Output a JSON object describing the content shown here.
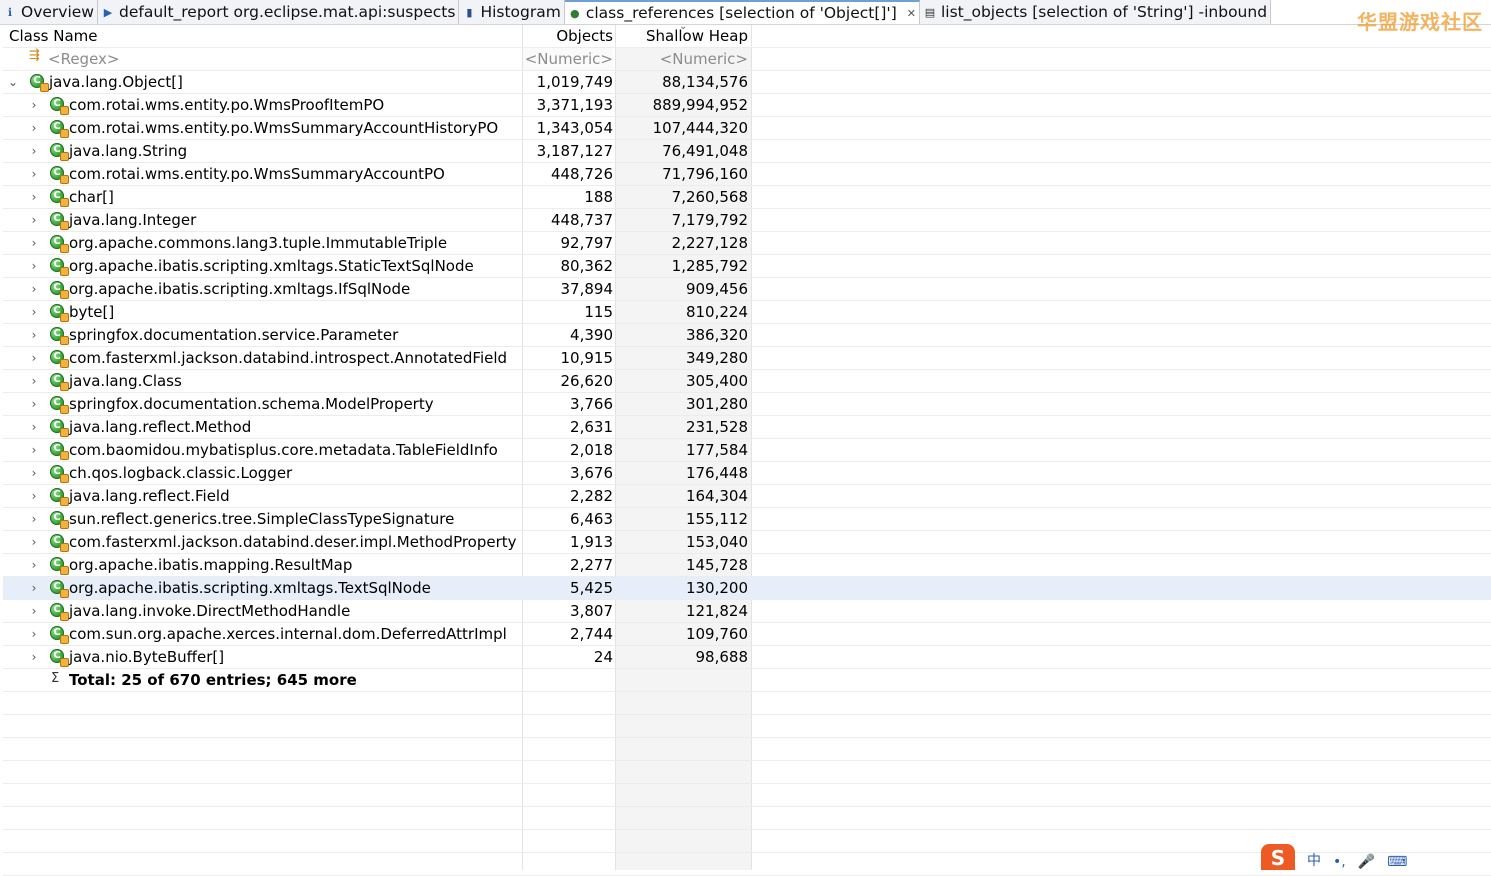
{
  "tabs": [
    {
      "label": "Overview",
      "icon": "info-icon",
      "active": false
    },
    {
      "label": "default_report  org.eclipse.mat.api:suspects",
      "icon": "report-icon",
      "active": false
    },
    {
      "label": "Histogram",
      "icon": "histogram-icon",
      "active": false
    },
    {
      "label": "class_references  [selection of 'Object[]']",
      "icon": "class-references-icon",
      "active": true
    },
    {
      "label": "list_objects  [selection of 'String'] -inbound",
      "icon": "list-objects-icon",
      "active": false
    }
  ],
  "watermark": "华盟游戏社区",
  "columns": {
    "name": "Class Name",
    "objects": "Objects",
    "heap": "Shallow Heap"
  },
  "filter": {
    "name": "<Regex>",
    "objects": "<Numeric>",
    "heap": "<Numeric>"
  },
  "root": {
    "name": "java.lang.Object[]",
    "objects": "1,019,749",
    "heap": "88,134,576"
  },
  "rows": [
    {
      "name": "com.rotai.wms.entity.po.WmsProofItemPO",
      "objects": "3,371,193",
      "heap": "889,994,952"
    },
    {
      "name": "com.rotai.wms.entity.po.WmsSummaryAccountHistoryPO",
      "objects": "1,343,054",
      "heap": "107,444,320"
    },
    {
      "name": "java.lang.String",
      "objects": "3,187,127",
      "heap": "76,491,048"
    },
    {
      "name": "com.rotai.wms.entity.po.WmsSummaryAccountPO",
      "objects": "448,726",
      "heap": "71,796,160"
    },
    {
      "name": "char[]",
      "objects": "188",
      "heap": "7,260,568"
    },
    {
      "name": "java.lang.Integer",
      "objects": "448,737",
      "heap": "7,179,792"
    },
    {
      "name": "org.apache.commons.lang3.tuple.ImmutableTriple",
      "objects": "92,797",
      "heap": "2,227,128"
    },
    {
      "name": "org.apache.ibatis.scripting.xmltags.StaticTextSqlNode",
      "objects": "80,362",
      "heap": "1,285,792"
    },
    {
      "name": "org.apache.ibatis.scripting.xmltags.IfSqlNode",
      "objects": "37,894",
      "heap": "909,456"
    },
    {
      "name": "byte[]",
      "objects": "115",
      "heap": "810,224"
    },
    {
      "name": "springfox.documentation.service.Parameter",
      "objects": "4,390",
      "heap": "386,320"
    },
    {
      "name": "com.fasterxml.jackson.databind.introspect.AnnotatedField",
      "objects": "10,915",
      "heap": "349,280"
    },
    {
      "name": "java.lang.Class",
      "objects": "26,620",
      "heap": "305,400"
    },
    {
      "name": "springfox.documentation.schema.ModelProperty",
      "objects": "3,766",
      "heap": "301,280"
    },
    {
      "name": "java.lang.reflect.Method",
      "objects": "2,631",
      "heap": "231,528"
    },
    {
      "name": "com.baomidou.mybatisplus.core.metadata.TableFieldInfo",
      "objects": "2,018",
      "heap": "177,584"
    },
    {
      "name": "ch.qos.logback.classic.Logger",
      "objects": "3,676",
      "heap": "176,448"
    },
    {
      "name": "java.lang.reflect.Field",
      "objects": "2,282",
      "heap": "164,304"
    },
    {
      "name": "sun.reflect.generics.tree.SimpleClassTypeSignature",
      "objects": "6,463",
      "heap": "155,112"
    },
    {
      "name": "com.fasterxml.jackson.databind.deser.impl.MethodProperty",
      "objects": "1,913",
      "heap": "153,040"
    },
    {
      "name": "org.apache.ibatis.mapping.ResultMap",
      "objects": "2,277",
      "heap": "145,728"
    },
    {
      "name": "org.apache.ibatis.scripting.xmltags.TextSqlNode",
      "objects": "5,425",
      "heap": "130,200",
      "selected": true
    },
    {
      "name": "java.lang.invoke.DirectMethodHandle",
      "objects": "3,807",
      "heap": "121,824"
    },
    {
      "name": "com.sun.org.apache.xerces.internal.dom.DeferredAttrImpl",
      "objects": "2,744",
      "heap": "109,760"
    },
    {
      "name": "java.nio.ByteBuffer[]",
      "objects": "24",
      "heap": "98,688"
    }
  ],
  "total": "Total: 25 of 670 entries; 645 more",
  "tray": [
    "中",
    "•,",
    "🎤",
    "⌨"
  ],
  "tray_logo": "S"
}
